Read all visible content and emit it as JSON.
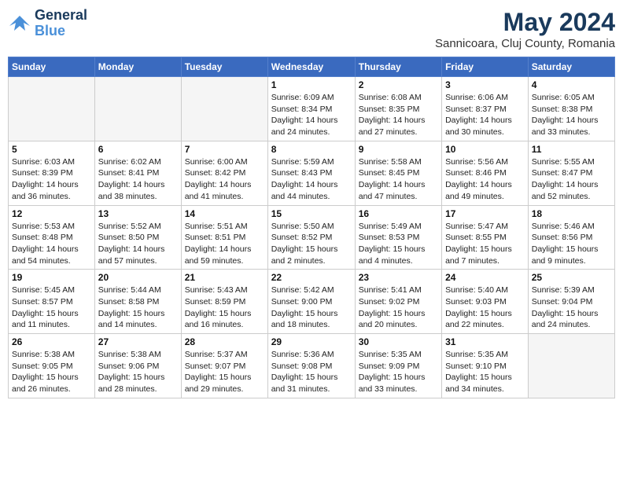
{
  "header": {
    "logo_line1": "General",
    "logo_line2": "Blue",
    "month_year": "May 2024",
    "location": "Sannicoara, Cluj County, Romania"
  },
  "weekdays": [
    "Sunday",
    "Monday",
    "Tuesday",
    "Wednesday",
    "Thursday",
    "Friday",
    "Saturday"
  ],
  "weeks": [
    [
      {
        "day": "",
        "detail": ""
      },
      {
        "day": "",
        "detail": ""
      },
      {
        "day": "",
        "detail": ""
      },
      {
        "day": "1",
        "detail": "Sunrise: 6:09 AM\nSunset: 8:34 PM\nDaylight: 14 hours\nand 24 minutes."
      },
      {
        "day": "2",
        "detail": "Sunrise: 6:08 AM\nSunset: 8:35 PM\nDaylight: 14 hours\nand 27 minutes."
      },
      {
        "day": "3",
        "detail": "Sunrise: 6:06 AM\nSunset: 8:37 PM\nDaylight: 14 hours\nand 30 minutes."
      },
      {
        "day": "4",
        "detail": "Sunrise: 6:05 AM\nSunset: 8:38 PM\nDaylight: 14 hours\nand 33 minutes."
      }
    ],
    [
      {
        "day": "5",
        "detail": "Sunrise: 6:03 AM\nSunset: 8:39 PM\nDaylight: 14 hours\nand 36 minutes."
      },
      {
        "day": "6",
        "detail": "Sunrise: 6:02 AM\nSunset: 8:41 PM\nDaylight: 14 hours\nand 38 minutes."
      },
      {
        "day": "7",
        "detail": "Sunrise: 6:00 AM\nSunset: 8:42 PM\nDaylight: 14 hours\nand 41 minutes."
      },
      {
        "day": "8",
        "detail": "Sunrise: 5:59 AM\nSunset: 8:43 PM\nDaylight: 14 hours\nand 44 minutes."
      },
      {
        "day": "9",
        "detail": "Sunrise: 5:58 AM\nSunset: 8:45 PM\nDaylight: 14 hours\nand 47 minutes."
      },
      {
        "day": "10",
        "detail": "Sunrise: 5:56 AM\nSunset: 8:46 PM\nDaylight: 14 hours\nand 49 minutes."
      },
      {
        "day": "11",
        "detail": "Sunrise: 5:55 AM\nSunset: 8:47 PM\nDaylight: 14 hours\nand 52 minutes."
      }
    ],
    [
      {
        "day": "12",
        "detail": "Sunrise: 5:53 AM\nSunset: 8:48 PM\nDaylight: 14 hours\nand 54 minutes."
      },
      {
        "day": "13",
        "detail": "Sunrise: 5:52 AM\nSunset: 8:50 PM\nDaylight: 14 hours\nand 57 minutes."
      },
      {
        "day": "14",
        "detail": "Sunrise: 5:51 AM\nSunset: 8:51 PM\nDaylight: 14 hours\nand 59 minutes."
      },
      {
        "day": "15",
        "detail": "Sunrise: 5:50 AM\nSunset: 8:52 PM\nDaylight: 15 hours\nand 2 minutes."
      },
      {
        "day": "16",
        "detail": "Sunrise: 5:49 AM\nSunset: 8:53 PM\nDaylight: 15 hours\nand 4 minutes."
      },
      {
        "day": "17",
        "detail": "Sunrise: 5:47 AM\nSunset: 8:55 PM\nDaylight: 15 hours\nand 7 minutes."
      },
      {
        "day": "18",
        "detail": "Sunrise: 5:46 AM\nSunset: 8:56 PM\nDaylight: 15 hours\nand 9 minutes."
      }
    ],
    [
      {
        "day": "19",
        "detail": "Sunrise: 5:45 AM\nSunset: 8:57 PM\nDaylight: 15 hours\nand 11 minutes."
      },
      {
        "day": "20",
        "detail": "Sunrise: 5:44 AM\nSunset: 8:58 PM\nDaylight: 15 hours\nand 14 minutes."
      },
      {
        "day": "21",
        "detail": "Sunrise: 5:43 AM\nSunset: 8:59 PM\nDaylight: 15 hours\nand 16 minutes."
      },
      {
        "day": "22",
        "detail": "Sunrise: 5:42 AM\nSunset: 9:00 PM\nDaylight: 15 hours\nand 18 minutes."
      },
      {
        "day": "23",
        "detail": "Sunrise: 5:41 AM\nSunset: 9:02 PM\nDaylight: 15 hours\nand 20 minutes."
      },
      {
        "day": "24",
        "detail": "Sunrise: 5:40 AM\nSunset: 9:03 PM\nDaylight: 15 hours\nand 22 minutes."
      },
      {
        "day": "25",
        "detail": "Sunrise: 5:39 AM\nSunset: 9:04 PM\nDaylight: 15 hours\nand 24 minutes."
      }
    ],
    [
      {
        "day": "26",
        "detail": "Sunrise: 5:38 AM\nSunset: 9:05 PM\nDaylight: 15 hours\nand 26 minutes."
      },
      {
        "day": "27",
        "detail": "Sunrise: 5:38 AM\nSunset: 9:06 PM\nDaylight: 15 hours\nand 28 minutes."
      },
      {
        "day": "28",
        "detail": "Sunrise: 5:37 AM\nSunset: 9:07 PM\nDaylight: 15 hours\nand 29 minutes."
      },
      {
        "day": "29",
        "detail": "Sunrise: 5:36 AM\nSunset: 9:08 PM\nDaylight: 15 hours\nand 31 minutes."
      },
      {
        "day": "30",
        "detail": "Sunrise: 5:35 AM\nSunset: 9:09 PM\nDaylight: 15 hours\nand 33 minutes."
      },
      {
        "day": "31",
        "detail": "Sunrise: 5:35 AM\nSunset: 9:10 PM\nDaylight: 15 hours\nand 34 minutes."
      },
      {
        "day": "",
        "detail": ""
      }
    ]
  ]
}
